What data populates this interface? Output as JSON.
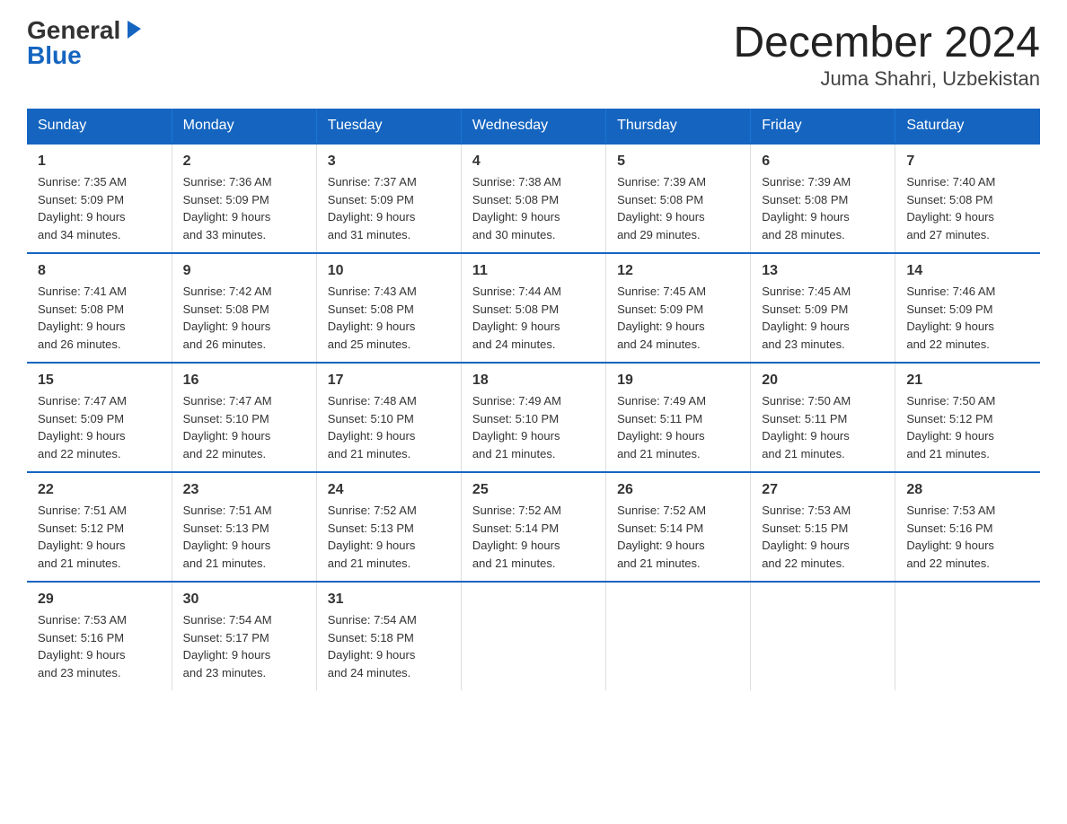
{
  "logo": {
    "general": "General",
    "blue": "Blue",
    "triangle": "▶"
  },
  "title": "December 2024",
  "subtitle": "Juma Shahri, Uzbekistan",
  "days_of_week": [
    "Sunday",
    "Monday",
    "Tuesday",
    "Wednesday",
    "Thursday",
    "Friday",
    "Saturday"
  ],
  "weeks": [
    [
      {
        "day": "1",
        "sunrise": "7:35 AM",
        "sunset": "5:09 PM",
        "daylight": "9 hours and 34 minutes."
      },
      {
        "day": "2",
        "sunrise": "7:36 AM",
        "sunset": "5:09 PM",
        "daylight": "9 hours and 33 minutes."
      },
      {
        "day": "3",
        "sunrise": "7:37 AM",
        "sunset": "5:09 PM",
        "daylight": "9 hours and 31 minutes."
      },
      {
        "day": "4",
        "sunrise": "7:38 AM",
        "sunset": "5:08 PM",
        "daylight": "9 hours and 30 minutes."
      },
      {
        "day": "5",
        "sunrise": "7:39 AM",
        "sunset": "5:08 PM",
        "daylight": "9 hours and 29 minutes."
      },
      {
        "day": "6",
        "sunrise": "7:39 AM",
        "sunset": "5:08 PM",
        "daylight": "9 hours and 28 minutes."
      },
      {
        "day": "7",
        "sunrise": "7:40 AM",
        "sunset": "5:08 PM",
        "daylight": "9 hours and 27 minutes."
      }
    ],
    [
      {
        "day": "8",
        "sunrise": "7:41 AM",
        "sunset": "5:08 PM",
        "daylight": "9 hours and 26 minutes."
      },
      {
        "day": "9",
        "sunrise": "7:42 AM",
        "sunset": "5:08 PM",
        "daylight": "9 hours and 26 minutes."
      },
      {
        "day": "10",
        "sunrise": "7:43 AM",
        "sunset": "5:08 PM",
        "daylight": "9 hours and 25 minutes."
      },
      {
        "day": "11",
        "sunrise": "7:44 AM",
        "sunset": "5:08 PM",
        "daylight": "9 hours and 24 minutes."
      },
      {
        "day": "12",
        "sunrise": "7:45 AM",
        "sunset": "5:09 PM",
        "daylight": "9 hours and 24 minutes."
      },
      {
        "day": "13",
        "sunrise": "7:45 AM",
        "sunset": "5:09 PM",
        "daylight": "9 hours and 23 minutes."
      },
      {
        "day": "14",
        "sunrise": "7:46 AM",
        "sunset": "5:09 PM",
        "daylight": "9 hours and 22 minutes."
      }
    ],
    [
      {
        "day": "15",
        "sunrise": "7:47 AM",
        "sunset": "5:09 PM",
        "daylight": "9 hours and 22 minutes."
      },
      {
        "day": "16",
        "sunrise": "7:47 AM",
        "sunset": "5:10 PM",
        "daylight": "9 hours and 22 minutes."
      },
      {
        "day": "17",
        "sunrise": "7:48 AM",
        "sunset": "5:10 PM",
        "daylight": "9 hours and 21 minutes."
      },
      {
        "day": "18",
        "sunrise": "7:49 AM",
        "sunset": "5:10 PM",
        "daylight": "9 hours and 21 minutes."
      },
      {
        "day": "19",
        "sunrise": "7:49 AM",
        "sunset": "5:11 PM",
        "daylight": "9 hours and 21 minutes."
      },
      {
        "day": "20",
        "sunrise": "7:50 AM",
        "sunset": "5:11 PM",
        "daylight": "9 hours and 21 minutes."
      },
      {
        "day": "21",
        "sunrise": "7:50 AM",
        "sunset": "5:12 PM",
        "daylight": "9 hours and 21 minutes."
      }
    ],
    [
      {
        "day": "22",
        "sunrise": "7:51 AM",
        "sunset": "5:12 PM",
        "daylight": "9 hours and 21 minutes."
      },
      {
        "day": "23",
        "sunrise": "7:51 AM",
        "sunset": "5:13 PM",
        "daylight": "9 hours and 21 minutes."
      },
      {
        "day": "24",
        "sunrise": "7:52 AM",
        "sunset": "5:13 PM",
        "daylight": "9 hours and 21 minutes."
      },
      {
        "day": "25",
        "sunrise": "7:52 AM",
        "sunset": "5:14 PM",
        "daylight": "9 hours and 21 minutes."
      },
      {
        "day": "26",
        "sunrise": "7:52 AM",
        "sunset": "5:14 PM",
        "daylight": "9 hours and 21 minutes."
      },
      {
        "day": "27",
        "sunrise": "7:53 AM",
        "sunset": "5:15 PM",
        "daylight": "9 hours and 22 minutes."
      },
      {
        "day": "28",
        "sunrise": "7:53 AM",
        "sunset": "5:16 PM",
        "daylight": "9 hours and 22 minutes."
      }
    ],
    [
      {
        "day": "29",
        "sunrise": "7:53 AM",
        "sunset": "5:16 PM",
        "daylight": "9 hours and 23 minutes."
      },
      {
        "day": "30",
        "sunrise": "7:54 AM",
        "sunset": "5:17 PM",
        "daylight": "9 hours and 23 minutes."
      },
      {
        "day": "31",
        "sunrise": "7:54 AM",
        "sunset": "5:18 PM",
        "daylight": "9 hours and 24 minutes."
      },
      null,
      null,
      null,
      null
    ]
  ],
  "labels": {
    "sunrise": "Sunrise:",
    "sunset": "Sunset:",
    "daylight": "Daylight:"
  }
}
